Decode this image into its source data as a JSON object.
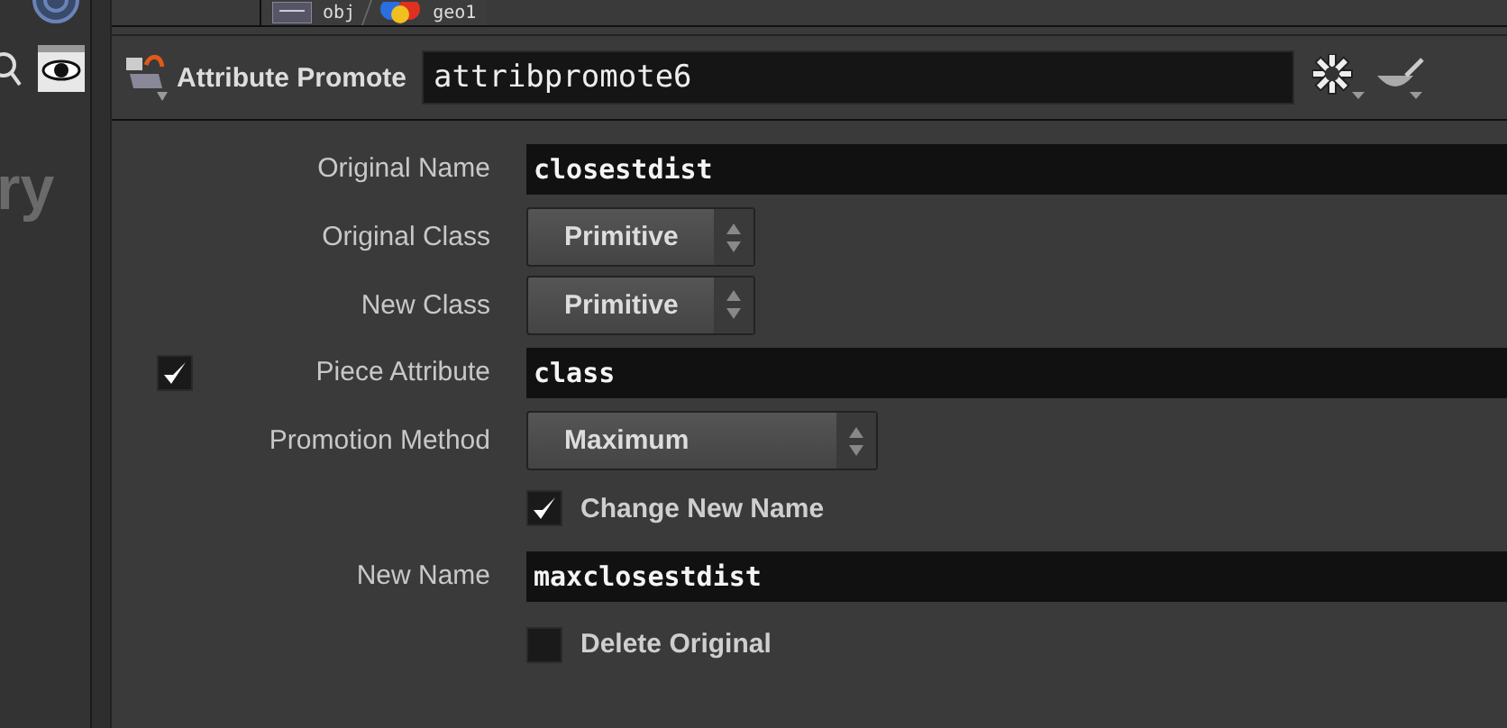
{
  "path_bar": {
    "items": [
      {
        "label": "obj"
      },
      {
        "label": "geo1"
      }
    ]
  },
  "side_panel": {
    "label": "ry"
  },
  "node": {
    "type": "Attribute Promote",
    "name": "attribpromote6"
  },
  "parameters": [
    {
      "kind": "text",
      "label": "Original Name",
      "value": "closestdist"
    },
    {
      "kind": "menu",
      "label": "Original Class",
      "value": "Primitive"
    },
    {
      "kind": "menu",
      "label": "New Class",
      "value": "Primitive"
    },
    {
      "kind": "text",
      "label": "Piece Attribute",
      "value": "class",
      "checked": true
    },
    {
      "kind": "menu",
      "label": "Promotion Method",
      "value": "Maximum"
    },
    {
      "kind": "toggle",
      "label": "Change New Name",
      "checked": true
    },
    {
      "kind": "text",
      "label": "New Name",
      "value": "maxclosestdist"
    },
    {
      "kind": "toggle",
      "label": "Delete Original",
      "checked": false
    }
  ]
}
